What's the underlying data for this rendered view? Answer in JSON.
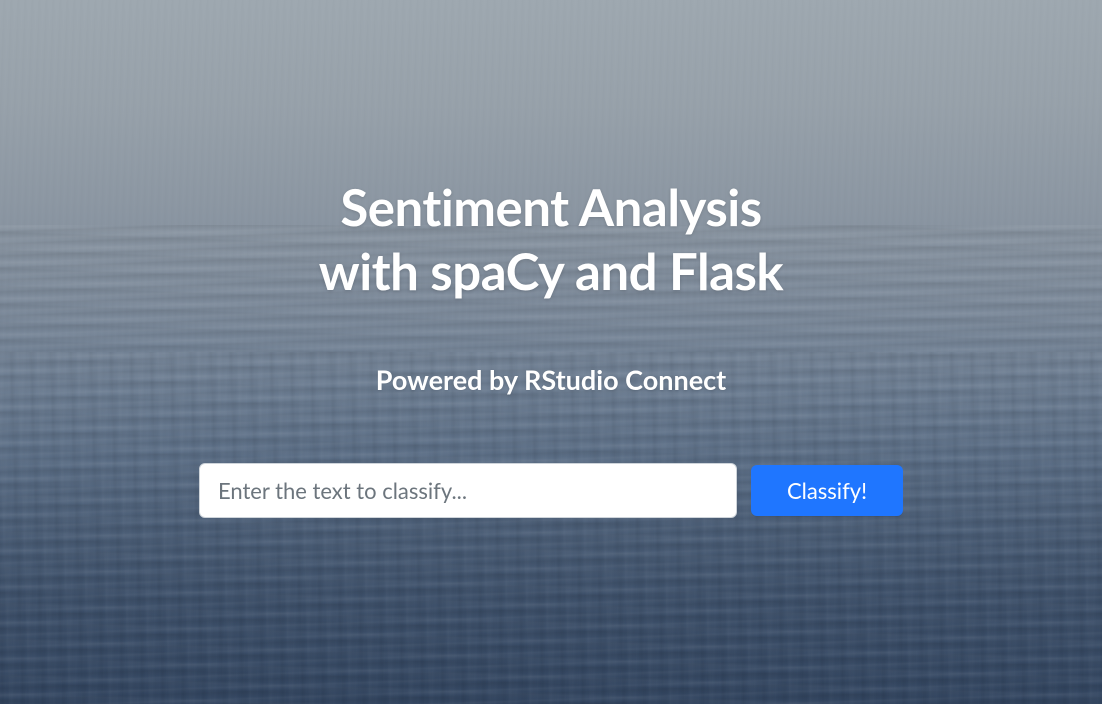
{
  "hero": {
    "title_line1": "Sentiment Analysis",
    "title_line2": "with spaCy and Flask",
    "subtitle": "Powered by RStudio Connect"
  },
  "form": {
    "input_placeholder": "Enter the text to classify...",
    "input_value": "",
    "button_label": "Classify!"
  },
  "colors": {
    "accent": "#1f76ff",
    "text_on_dark": "#ffffff",
    "placeholder": "#6c757d"
  }
}
